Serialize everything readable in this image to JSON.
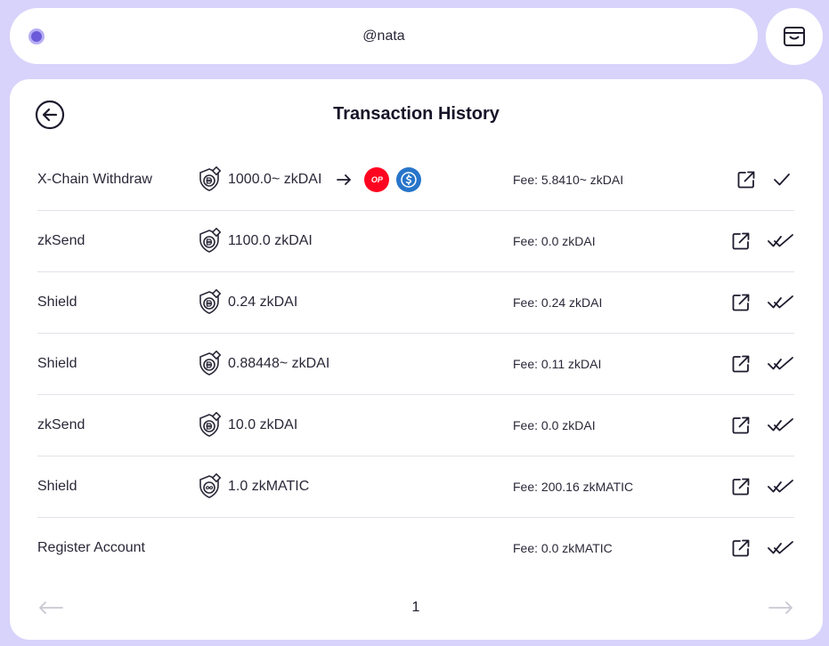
{
  "header": {
    "username": "@nata"
  },
  "card": {
    "title": "Transaction History"
  },
  "transactions": [
    {
      "type": "X-Chain Withdraw",
      "amount": "1000.0~ zkDAI",
      "token": "dai",
      "fee": "Fee: 5.8410~ zkDAI",
      "status": "single-check",
      "chains": [
        "OP",
        "USDC"
      ]
    },
    {
      "type": "zkSend",
      "amount": "1100.0 zkDAI",
      "token": "dai",
      "fee": "Fee: 0.0 zkDAI",
      "status": "double-check"
    },
    {
      "type": "Shield",
      "amount": "0.24 zkDAI",
      "token": "dai",
      "fee": "Fee: 0.24 zkDAI",
      "status": "double-check"
    },
    {
      "type": "Shield",
      "amount": "0.88448~ zkDAI",
      "token": "dai",
      "fee": "Fee: 0.11 zkDAI",
      "status": "double-check"
    },
    {
      "type": "zkSend",
      "amount": "10.0 zkDAI",
      "token": "dai",
      "fee": "Fee: 0.0 zkDAI",
      "status": "double-check"
    },
    {
      "type": "Shield",
      "amount": "1.0 zkMATIC",
      "token": "matic",
      "fee": "Fee: 200.16 zkMATIC",
      "status": "double-check"
    },
    {
      "type": "Register Account",
      "amount": "",
      "token": "",
      "fee": "Fee: 0.0 zkMATIC",
      "status": "double-check"
    }
  ],
  "pagination": {
    "current_page": "1"
  },
  "colors": {
    "background": "#d8d3fb",
    "accent": "#6c5bd9",
    "op_red": "#ff0420",
    "usdc_blue": "#2775ca"
  }
}
